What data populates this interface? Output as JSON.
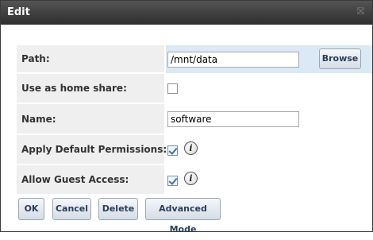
{
  "dialog": {
    "title": "Edit",
    "close_glyph": "⛝",
    "close_icon": "close-icon"
  },
  "form": {
    "path": {
      "label": "Path:",
      "value": "/mnt/data",
      "browse_label": "Browse"
    },
    "home_share": {
      "label": "Use as home share:",
      "checked": false
    },
    "name": {
      "label": "Name:",
      "value": "software"
    },
    "default_permissions": {
      "label": "Apply Default Permissions:",
      "checked": true,
      "info_glyph": "i",
      "info_icon": "info-icon"
    },
    "guest_access": {
      "label": "Allow Guest Access:",
      "checked": true,
      "info_glyph": "i",
      "info_icon": "info-icon"
    }
  },
  "buttons": {
    "ok": "OK",
    "cancel": "Cancel",
    "delete": "Delete",
    "advanced": "Advanced Mode"
  },
  "colors": {
    "titlebar": "#3a3a3a",
    "label_bg": "#efefef",
    "highlight_row": "#dbe9f7",
    "button_text": "#2a3d5c"
  }
}
